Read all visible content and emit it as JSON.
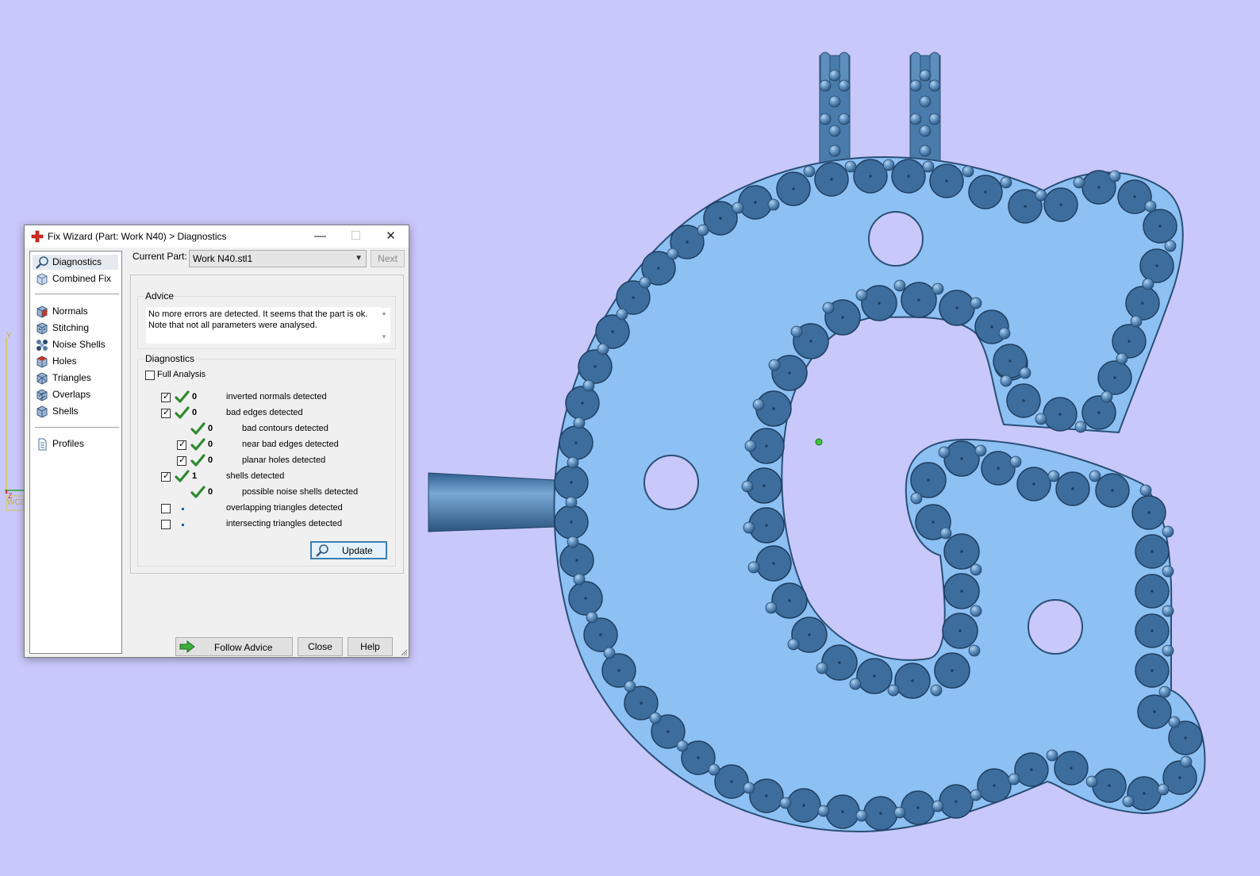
{
  "window": {
    "title": "Fix Wizard (Part: Work N40) > Diagnostics",
    "minimize": "—",
    "maximize": "☐",
    "close": "✕"
  },
  "nav": {
    "items": [
      {
        "label": "Diagnostics",
        "icon": "magnifier-icon"
      },
      {
        "label": "Combined Fix",
        "icon": "cube-icon"
      },
      {
        "label": "Normals",
        "icon": "normals-cube-icon"
      },
      {
        "label": "Stitching",
        "icon": "stitching-cube-icon"
      },
      {
        "label": "Noise Shells",
        "icon": "noise-shells-icon"
      },
      {
        "label": "Holes",
        "icon": "holes-cube-icon"
      },
      {
        "label": "Triangles",
        "icon": "triangles-cube-icon"
      },
      {
        "label": "Overlaps",
        "icon": "overlaps-cube-icon"
      },
      {
        "label": "Shells",
        "icon": "shells-cube-icon"
      },
      {
        "label": "Profiles",
        "icon": "document-icon"
      }
    ],
    "selected": "Diagnostics"
  },
  "current_part": {
    "label": "Current Part:",
    "value": "Work N40.stl1",
    "next": "Next"
  },
  "advice": {
    "title": "Advice",
    "line1": "No more errors are detected. It seems that the part is ok.",
    "line2": "Note that not all parameters were analysed."
  },
  "diagnostics": {
    "title": "Diagnostics",
    "full_analysis": "Full Analysis",
    "rows": [
      {
        "count": "0",
        "text": "inverted normals detected"
      },
      {
        "count": "0",
        "text": "bad edges detected"
      },
      {
        "count": "0",
        "text": "bad contours detected"
      },
      {
        "count": "0",
        "text": "near bad edges detected"
      },
      {
        "count": "0",
        "text": "planar holes detected"
      },
      {
        "count": "1",
        "text": "shells detected"
      },
      {
        "count": "0",
        "text": "possible noise shells detected"
      },
      {
        "count": "",
        "text": "overlapping triangles detected"
      },
      {
        "count": "",
        "text": "intersecting triangles detected"
      }
    ],
    "update": "Update"
  },
  "footer": {
    "follow_advice": "Follow Advice",
    "close": "Close",
    "help": "Help"
  },
  "viewport": {
    "axis_y": "Y",
    "axis_z": "Z",
    "wcs": "WCS"
  },
  "colors": {
    "viewport_bg": "#c9c8fb",
    "part_fill": "#8dc0f3",
    "support_dark": "#3d6d9d",
    "support_light": "#6f9fcc",
    "check_green": "#2e8b2e"
  }
}
